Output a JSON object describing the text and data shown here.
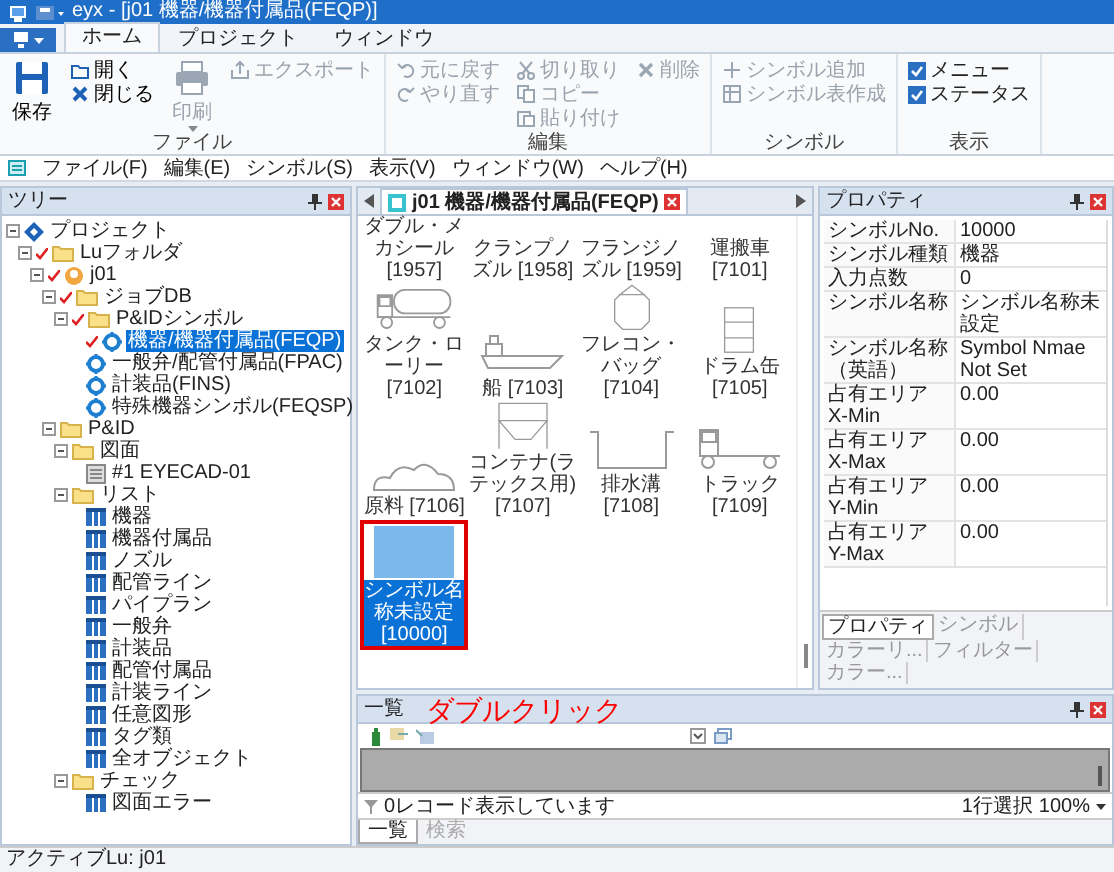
{
  "window": {
    "title": "eyx - [j01 機器/機器付属品(FEQP)]"
  },
  "ribbon": {
    "tabs": [
      {
        "label": "ホーム",
        "selected": true
      },
      {
        "label": "プロジェクト",
        "selected": false
      },
      {
        "label": "ウィンドウ",
        "selected": false
      }
    ],
    "groups": [
      {
        "label": "ファイル",
        "columns": [
          [
            {
              "label": "保存",
              "kind": "large",
              "disabled": false
            }
          ],
          [
            {
              "label": "開く",
              "kind": "small",
              "disabled": false
            },
            {
              "label": "閉じる",
              "kind": "small",
              "disabled": false
            }
          ],
          [
            {
              "label": "印刷",
              "kind": "large",
              "disabled": true
            }
          ],
          [
            {
              "label": "エクスポート",
              "kind": "small",
              "disabled": true
            }
          ]
        ]
      },
      {
        "label": "編集",
        "columns": [
          [
            {
              "label": "元に戻す",
              "kind": "small",
              "disabled": true
            },
            {
              "label": "やり直す",
              "kind": "small",
              "disabled": true
            }
          ],
          [
            {
              "label": "切り取り",
              "kind": "small",
              "disabled": true
            },
            {
              "label": "コピー",
              "kind": "small",
              "disabled": true
            },
            {
              "label": "貼り付け",
              "kind": "small",
              "disabled": true
            }
          ],
          [
            {
              "label": "削除",
              "kind": "small",
              "disabled": true
            }
          ]
        ]
      },
      {
        "label": "シンボル",
        "columns": [
          [
            {
              "label": "シンボル追加",
              "kind": "small",
              "disabled": true
            },
            {
              "label": "シンボル表作成",
              "kind": "small",
              "disabled": true
            }
          ]
        ]
      },
      {
        "label": "表示",
        "columns": [
          [
            {
              "label": "メニュー",
              "kind": "check",
              "checked": true
            },
            {
              "label": "ステータス",
              "kind": "check",
              "checked": true
            }
          ]
        ]
      }
    ]
  },
  "menu": [
    "ファイル(F)",
    "編集(E)",
    "シンボル(S)",
    "表示(V)",
    "ウィンドウ(W)",
    "ヘルプ(H)"
  ],
  "tree": {
    "title": "ツリー",
    "items": [
      {
        "label": "プロジェクト",
        "kind": "project",
        "marked": false,
        "selected": false,
        "expanded": true,
        "children": [
          {
            "label": "Luフォルダ",
            "kind": "folder",
            "marked": true,
            "selected": false,
            "expanded": true,
            "children": [
              {
                "label": "j01",
                "kind": "job",
                "marked": true,
                "selected": false,
                "expanded": true,
                "children": [
                  {
                    "label": "ジョブDB",
                    "kind": "folder",
                    "marked": true,
                    "selected": false,
                    "expanded": true,
                    "children": [
                      {
                        "label": "P&IDシンボル",
                        "kind": "folder",
                        "marked": true,
                        "selected": false,
                        "expanded": true,
                        "children": [
                          {
                            "label": "機器/機器付属品(FEQP)",
                            "kind": "symbol-set",
                            "marked": true,
                            "selected": true
                          },
                          {
                            "label": "一般弁/配管付属品(FPAC)",
                            "kind": "symbol-set",
                            "marked": false,
                            "selected": false
                          },
                          {
                            "label": "計装品(FINS)",
                            "kind": "symbol-set",
                            "marked": false,
                            "selected": false
                          },
                          {
                            "label": "特殊機器シンボル(FEQSP)",
                            "kind": "symbol-set",
                            "marked": false,
                            "selected": false
                          }
                        ]
                      }
                    ]
                  },
                  {
                    "label": "P&ID",
                    "kind": "folder",
                    "marked": false,
                    "selected": false,
                    "expanded": true,
                    "children": [
                      {
                        "label": "図面",
                        "kind": "folder",
                        "marked": false,
                        "selected": false,
                        "expanded": true,
                        "children": [
                          {
                            "label": "#1 EYECAD-01",
                            "kind": "drawing",
                            "marked": false,
                            "selected": false
                          }
                        ]
                      },
                      {
                        "label": "リスト",
                        "kind": "folder",
                        "marked": false,
                        "selected": false,
                        "expanded": true,
                        "children": [
                          {
                            "label": "機器",
                            "kind": "list",
                            "marked": false,
                            "selected": false
                          },
                          {
                            "label": "機器付属品",
                            "kind": "list",
                            "marked": false,
                            "selected": false
                          },
                          {
                            "label": "ノズル",
                            "kind": "list",
                            "marked": false,
                            "selected": false
                          },
                          {
                            "label": "配管ライン",
                            "kind": "list",
                            "marked": false,
                            "selected": false
                          },
                          {
                            "label": "パイプラン",
                            "kind": "list",
                            "marked": false,
                            "selected": false
                          },
                          {
                            "label": "一般弁",
                            "kind": "list",
                            "marked": false,
                            "selected": false
                          },
                          {
                            "label": "計装品",
                            "kind": "list",
                            "marked": false,
                            "selected": false
                          },
                          {
                            "label": "配管付属品",
                            "kind": "list",
                            "marked": false,
                            "selected": false
                          },
                          {
                            "label": "計装ライン",
                            "kind": "list",
                            "marked": false,
                            "selected": false
                          },
                          {
                            "label": "任意図形",
                            "kind": "list",
                            "marked": false,
                            "selected": false
                          },
                          {
                            "label": "タグ類",
                            "kind": "list",
                            "marked": false,
                            "selected": false
                          },
                          {
                            "label": "全オブジェクト",
                            "kind": "list",
                            "marked": false,
                            "selected": false
                          }
                        ]
                      },
                      {
                        "label": "チェック",
                        "kind": "folder",
                        "marked": false,
                        "selected": false,
                        "expanded": true,
                        "children": [
                          {
                            "label": "図面エラー",
                            "kind": "list",
                            "marked": false,
                            "selected": false
                          }
                        ]
                      }
                    ]
                  }
                ]
              }
            ]
          }
        ]
      }
    ]
  },
  "document": {
    "tab": "j01 機器/機器付属品(FEQP)",
    "symbols": [
      {
        "label": "ダブル・メカシール [1957]",
        "kind": "cut",
        "selected": false,
        "highlighted": false
      },
      {
        "label": "クランプノズル [1958]",
        "kind": "cut",
        "selected": false,
        "highlighted": false
      },
      {
        "label": "フランジノズル [1959]",
        "kind": "cut",
        "selected": false,
        "highlighted": false
      },
      {
        "label": "運搬車 [7101]",
        "kind": "cut",
        "selected": false,
        "highlighted": false
      },
      {
        "label": "タンク・ローリー [7102]",
        "kind": "tank-lorry",
        "selected": false,
        "highlighted": false
      },
      {
        "label": "船 [7103]",
        "kind": "ship",
        "selected": false,
        "highlighted": false
      },
      {
        "label": "フレコン・バッグ [7104]",
        "kind": "bag",
        "selected": false,
        "highlighted": false
      },
      {
        "label": "ドラム缶 [7105]",
        "kind": "drum",
        "selected": false,
        "highlighted": false
      },
      {
        "label": "原料 [7106]",
        "kind": "raw",
        "selected": false,
        "highlighted": false
      },
      {
        "label": "コンテナ(ラテックス用) [7107]",
        "kind": "hopper",
        "selected": false,
        "highlighted": false
      },
      {
        "label": "排水溝 [7108]",
        "kind": "trench",
        "selected": false,
        "highlighted": false
      },
      {
        "label": "トラック [7109]",
        "kind": "truck",
        "selected": false,
        "highlighted": false
      },
      {
        "label": "シンボル名称未設定 [10000]",
        "kind": "blank",
        "selected": true,
        "highlighted": true
      }
    ]
  },
  "properties": {
    "title": "プロパティ",
    "rows": [
      {
        "name": "シンボルNo.",
        "value": "10000"
      },
      {
        "name": "シンボル種類",
        "value": "機器"
      },
      {
        "name": "入力点数",
        "value": "0"
      },
      {
        "name": "シンボル名称",
        "value": "シンボル名称未設定"
      },
      {
        "name": "シンボル名称（英語）",
        "value": "Symbol Nmae Not Set"
      },
      {
        "name": "占有エリア X-Min",
        "value": "0.00"
      },
      {
        "name": "占有エリア X-Max",
        "value": "0.00"
      },
      {
        "name": "占有エリア Y-Min",
        "value": "0.00"
      },
      {
        "name": "占有エリア Y-Max",
        "value": "0.00"
      }
    ],
    "tabs": [
      {
        "label": "プロパティ",
        "selected": true
      },
      {
        "label": "シンボル",
        "selected": false
      },
      {
        "label": "カラーリ...",
        "selected": false
      },
      {
        "label": "フィルター",
        "selected": false
      },
      {
        "label": "カラー...",
        "selected": false
      }
    ]
  },
  "list_panel": {
    "title": "一覧",
    "annotation": "ダブルクリック",
    "status": "0レコード表示しています",
    "selection": "1行選択",
    "zoom": "100%",
    "tabs": [
      {
        "label": "一覧",
        "selected": true
      },
      {
        "label": "検索",
        "selected": false
      }
    ]
  },
  "status_bar": "アクティブLu: j01"
}
